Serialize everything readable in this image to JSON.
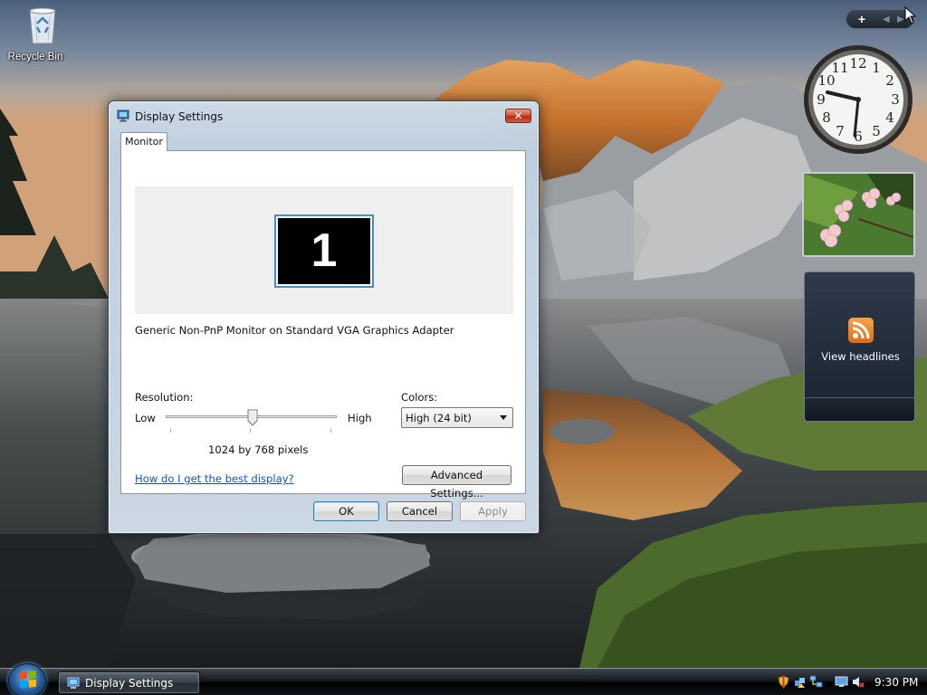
{
  "desktop": {
    "recycle_bin_label": "Recycle Bin"
  },
  "gadgets": {
    "feed_headlines_label": "View headlines"
  },
  "dialog": {
    "title": "Display Settings",
    "close_glyph": "✕",
    "tab_monitor": "Monitor",
    "monitor_number": "1",
    "monitor_name": "Generic Non-PnP Monitor on Standard VGA Graphics Adapter",
    "resolution_label": "Resolution:",
    "resolution_low": "Low",
    "resolution_high": "High",
    "resolution_value": "1024 by 768 pixels",
    "resolution_slider_fraction": 0.5,
    "colors_label": "Colors:",
    "colors_selected": "High (24 bit)",
    "help_link": "How do I get the best display?",
    "advanced_button": "Advanced Settings...",
    "ok_button": "OK",
    "cancel_button": "Cancel",
    "apply_button": "Apply"
  },
  "taskbar": {
    "active_item": "Display Settings",
    "clock": "9:30 PM"
  },
  "colors": {
    "accent_blue": "#3d8fd8",
    "link_blue": "#0b58c6",
    "close_red": "#c9402a"
  },
  "icons": [
    "recycle-bin-icon",
    "display-settings-icon",
    "close-icon",
    "rss-feed-icon",
    "start-orb-icon",
    "shield-icon",
    "network-icon",
    "volume-muted-icon",
    "mouse-cursor-icon",
    "chevron-down-icon"
  ]
}
